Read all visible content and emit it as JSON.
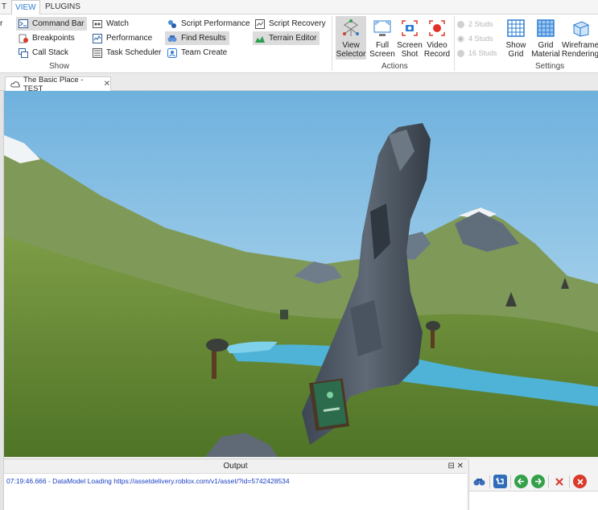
{
  "menu": {
    "tabs": [
      {
        "label": "T",
        "active": false
      },
      {
        "label": "VIEW",
        "active": true
      },
      {
        "label": "PLUGINS",
        "active": false
      }
    ]
  },
  "ribbon": {
    "show_group": {
      "label": "Show",
      "partial_item": "r",
      "items": [
        {
          "label": "Command Bar",
          "icon": "command-bar-icon",
          "selected": true
        },
        {
          "label": "Breakpoints",
          "icon": "breakpoints-icon"
        },
        {
          "label": "Call Stack",
          "icon": "call-stack-icon"
        },
        {
          "label": "Watch",
          "icon": "watch-icon"
        },
        {
          "label": "Performance",
          "icon": "performance-icon"
        },
        {
          "label": "Task Scheduler",
          "icon": "task-scheduler-icon"
        },
        {
          "label": "Script Performance",
          "icon": "script-performance-icon"
        },
        {
          "label": "Find Results",
          "icon": "find-results-icon",
          "selected": true
        },
        {
          "label": "Team Create",
          "icon": "team-create-icon"
        },
        {
          "label": "Script Recovery",
          "icon": "script-recovery-icon"
        },
        {
          "label": "Terrain Editor",
          "icon": "terrain-editor-icon",
          "selected": true
        }
      ]
    },
    "actions_group": {
      "label": "Actions",
      "buttons": [
        {
          "line1": "View",
          "line2": "Selector",
          "icon": "view-selector-icon",
          "selected": true
        },
        {
          "line1": "Full",
          "line2": "Screen",
          "icon": "full-screen-icon"
        },
        {
          "line1": "Screen",
          "line2": "Shot",
          "icon": "screenshot-icon"
        },
        {
          "line1": "Video",
          "line2": "Record",
          "icon": "video-record-icon"
        }
      ]
    },
    "settings_group": {
      "label": "Settings",
      "studs": [
        "2 Studs",
        "4 Studs",
        "16 Studs"
      ],
      "buttons": [
        {
          "line1": "Show",
          "line2": "Grid",
          "icon": "show-grid-icon"
        },
        {
          "line1": "Grid",
          "line2": "Material",
          "icon": "grid-material-icon"
        },
        {
          "line1": "Wireframe",
          "line2": "Rendering",
          "icon": "wireframe-icon"
        }
      ]
    }
  },
  "document": {
    "tab_title": "The Basic Place - TEST",
    "close_glyph": "✕"
  },
  "output": {
    "title": "Output",
    "pin_glyph": "⊟",
    "close_glyph": "✕",
    "log_line": "07:19:46.666 - DataModel Loading https://assetdelivery.roblox.com/v1/asset/?id=5742428534"
  },
  "colors": {
    "accent": "#2b7cd3",
    "log_text": "#1a3fc1",
    "sky": "#8ec8e8",
    "grass": "#6e8f3e",
    "water": "#4eb3d6"
  }
}
